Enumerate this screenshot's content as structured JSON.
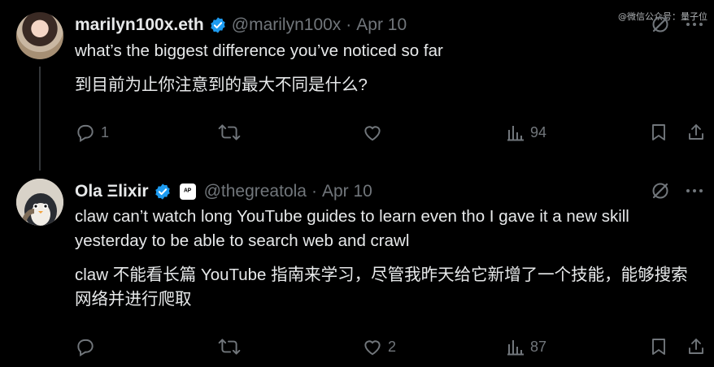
{
  "watermark": "@微信公众号：量子位",
  "tweets": [
    {
      "name": "marilyn100x.eth",
      "handle": "@marilyn100x",
      "dot": "·",
      "date": "Apr 10",
      "badge": "",
      "text_en": "what’s the biggest difference you’ve noticed so far",
      "text_zh": "到目前为止你注意到的最大不同是什么?",
      "reply_count": "1",
      "retweet_count": "",
      "like_count": "",
      "view_count": "94"
    },
    {
      "name": "Ola Ξlixir",
      "handle": "@thegreatola",
      "dot": "·",
      "date": "Apr 10",
      "badge": "ᴬᴾ",
      "text_en": "claw can’t watch long YouTube guides to learn even tho I gave it a new skill yesterday to be able to search web and crawl",
      "text_zh": "claw 不能看长篇 YouTube 指南来学习，尽管我昨天给它新增了一个技能，能够搜索网络并进行爬取",
      "reply_count": "",
      "retweet_count": "",
      "like_count": "2",
      "view_count": "87"
    }
  ],
  "icons": {
    "verified": "verified-badge-icon",
    "grok": "grok-icon",
    "more": "more-icon",
    "reply": "reply-icon",
    "retweet": "retweet-icon",
    "like": "like-icon",
    "views": "views-icon",
    "bookmark": "bookmark-icon",
    "share": "share-icon"
  },
  "colors": {
    "background": "#000000",
    "text": "#e7e9ea",
    "muted": "#71767b",
    "verified": "#1d9bf0"
  }
}
